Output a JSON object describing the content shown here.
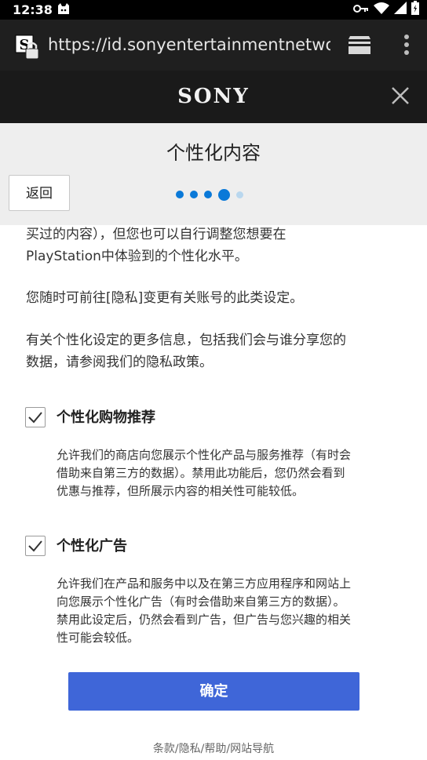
{
  "status_bar": {
    "time": "12:38",
    "icons": [
      "cat-notification-icon",
      "key-icon",
      "wifi-icon",
      "signal-icon",
      "battery-icon"
    ]
  },
  "browser": {
    "url": "https://id.sonyentertainmentnetwork",
    "site_icon_letter": "S"
  },
  "brand": {
    "logo_text": "SONY"
  },
  "header": {
    "title": "个性化内容",
    "back_label": "返回",
    "progress": {
      "total": 5,
      "current": 4
    }
  },
  "content": {
    "para1_line1": "买过的内容），但您也可以自行调整您想要在",
    "para1_line2": "PlayStation中体验到的个性化水平。",
    "para2": "您随时可前往[隐私]变更有关账号的此类设定。",
    "para3_line1": "有关个性化设定的更多信息，包括我们会与谁分享您的",
    "para3_line2": "数据，请参阅我们的隐私政策。",
    "options": [
      {
        "title": "个性化购物推荐",
        "checked": true,
        "desc_lines": [
          "允许我们的商店向您展示个性化产品与服务推荐（有时会",
          "借助来自第三方的数据）。禁用此功能后，您仍然会看到",
          "优惠与推荐，但所展示内容的相关性可能较低。"
        ]
      },
      {
        "title": "个性化广告",
        "checked": true,
        "desc_lines": [
          "允许我们在产品和服务中以及在第三方应用程序和网站上",
          "向您展示个性化广告（有时会借助来自第三方的数据）。",
          "禁用此设定后，仍然会看到广告，但广告与您兴趣的相关",
          "性可能会较低。"
        ]
      }
    ]
  },
  "confirm_label": "确定",
  "footer": "条款/隐私/帮助/网站导航",
  "colors": {
    "accent": "#0a79d8",
    "confirm_bg": "#3f66d8",
    "header_bg": "#eeeeee",
    "toolbar_bg": "#1f1f1f"
  }
}
